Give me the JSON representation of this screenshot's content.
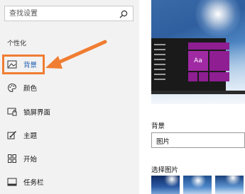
{
  "search": {
    "placeholder": "查找设置"
  },
  "nav": {
    "section_title": "个性化",
    "items": [
      {
        "label": "背景",
        "icon": "picture-icon",
        "active": true
      },
      {
        "label": "颜色",
        "icon": "palette-icon",
        "active": false
      },
      {
        "label": "锁屏界面",
        "icon": "lock-screen-icon",
        "active": false
      },
      {
        "label": "主题",
        "icon": "theme-icon",
        "active": false
      },
      {
        "label": "开始",
        "icon": "start-icon",
        "active": false
      },
      {
        "label": "任务栏",
        "icon": "taskbar-icon",
        "active": false
      }
    ]
  },
  "preview": {
    "tile_text": "Aa"
  },
  "background": {
    "label": "背景",
    "selected_value": "图片"
  },
  "picture_picker": {
    "label": "选择图片"
  },
  "colors": {
    "accent": "#8e1e92",
    "annotation": "#f07d32",
    "link": "#1e5db3"
  }
}
